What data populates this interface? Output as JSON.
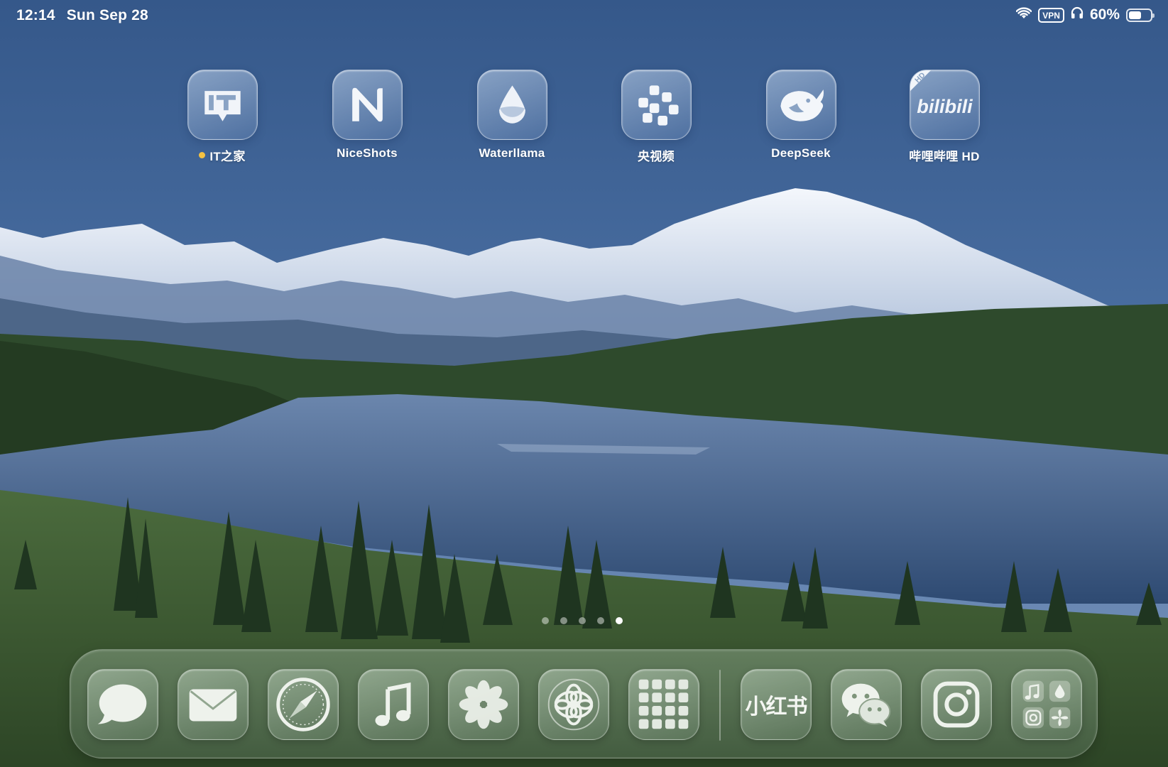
{
  "status_bar": {
    "time": "12:14",
    "date": "Sun Sep 28",
    "vpn": "VPN",
    "battery_percent": "60%",
    "battery_level": 0.6
  },
  "home_apps": [
    {
      "label": "IT之家",
      "icon": "it-home-icon",
      "has_new_badge": true
    },
    {
      "label": "NiceShots",
      "icon": "niceshots-icon"
    },
    {
      "label": "Waterllama",
      "icon": "water-drop-icon"
    },
    {
      "label": "央视频",
      "icon": "cctv-video-icon"
    },
    {
      "label": "DeepSeek",
      "icon": "whale-icon"
    },
    {
      "label": "哔哩哔哩 HD",
      "icon": "bilibili-icon",
      "icon_text": "bilibili",
      "badge_text": "HD"
    }
  ],
  "page_indicator": {
    "total": 5,
    "current": 5
  },
  "dock": {
    "apps": [
      {
        "name": "Messages",
        "icon": "chat-bubble-icon"
      },
      {
        "name": "Mail",
        "icon": "envelope-icon"
      },
      {
        "name": "Safari",
        "icon": "compass-icon"
      },
      {
        "name": "Music",
        "icon": "music-note-icon"
      },
      {
        "name": "Photos",
        "icon": "flower-icon"
      },
      {
        "name": "ChatGPT",
        "icon": "openai-knot-icon"
      },
      {
        "name": "App Library",
        "icon": "app-grid-icon"
      },
      {
        "name": "小红书",
        "icon": "xiaohongshu-icon",
        "icon_text": "小红书"
      },
      {
        "name": "WeChat",
        "icon": "wechat-icon"
      },
      {
        "name": "Instagram",
        "icon": "camera-outline-icon"
      },
      {
        "name": "Folder",
        "icon": "folder-icon"
      }
    ]
  }
}
